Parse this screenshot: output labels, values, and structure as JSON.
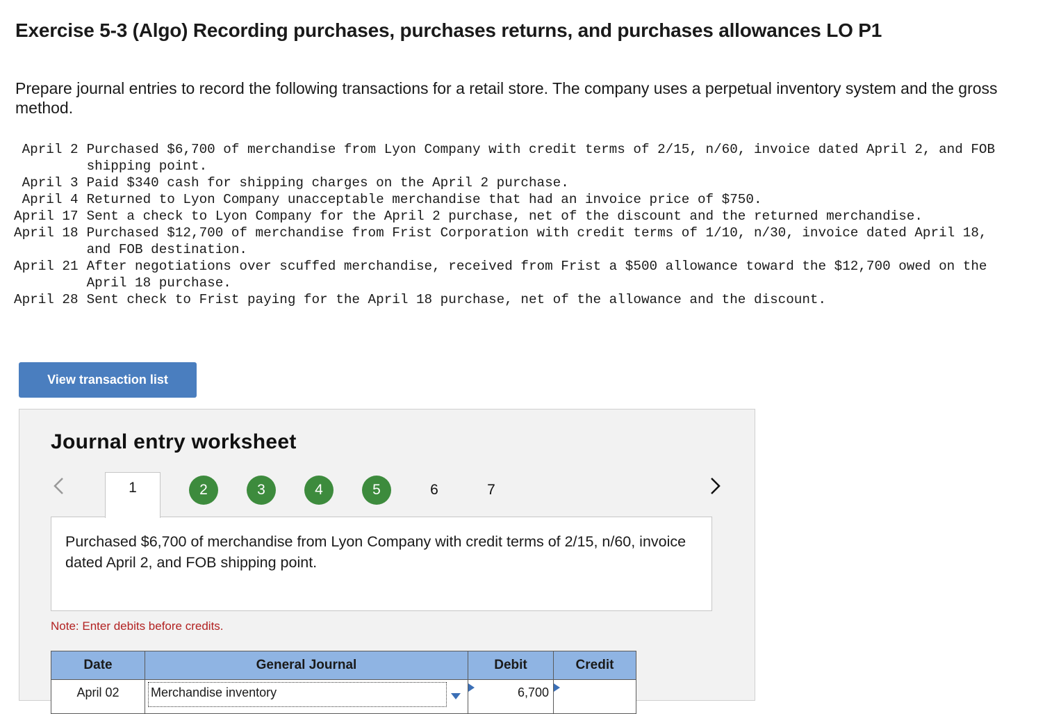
{
  "header": {
    "title": "Exercise 5-3 (Algo) Recording purchases, purchases returns, and purchases allowances LO P1",
    "intro": "Prepare journal entries to record the following transactions for a retail store. The company uses a perpetual inventory system and the gross method."
  },
  "transactions": [
    {
      "date": "April 2",
      "text": "Purchased $6,700 of merchandise from Lyon Company with credit terms of 2/15, n/60, invoice dated April 2, and FOB shipping point."
    },
    {
      "date": "April 3",
      "text": "Paid $340 cash for shipping charges on the April 2 purchase."
    },
    {
      "date": "April 4",
      "text": "Returned to Lyon Company unacceptable merchandise that had an invoice price of $750."
    },
    {
      "date": "April 17",
      "text": "Sent a check to Lyon Company for the April 2 purchase, net of the discount and the returned merchandise."
    },
    {
      "date": "April 18",
      "text": "Purchased $12,700 of merchandise from Frist Corporation with credit terms of 1/10, n/30, invoice dated April 18, and FOB destination."
    },
    {
      "date": "April 21",
      "text": "After negotiations over scuffed merchandise, received from Frist a $500 allowance toward the $12,700 owed on the April 18 purchase."
    },
    {
      "date": "April 28",
      "text": "Sent check to Frist paying for the April 18 purchase, net of the allowance and the discount."
    }
  ],
  "view_button": "View transaction list",
  "worksheet": {
    "title": "Journal entry worksheet",
    "steps": [
      {
        "label": "1",
        "state": "active"
      },
      {
        "label": "2",
        "state": "done"
      },
      {
        "label": "3",
        "state": "done"
      },
      {
        "label": "4",
        "state": "done"
      },
      {
        "label": "5",
        "state": "done"
      },
      {
        "label": "6",
        "state": "plain"
      },
      {
        "label": "7",
        "state": "plain"
      }
    ],
    "description": "Purchased $6,700 of merchandise from Lyon Company with credit terms of 2/15, n/60, invoice dated April 2, and FOB shipping point.",
    "note": "Note: Enter debits before credits.",
    "columns": {
      "date": "Date",
      "general_journal": "General Journal",
      "debit": "Debit",
      "credit": "Credit"
    },
    "rows": [
      {
        "date": "April 02",
        "account": "Merchandise inventory",
        "debit": "6,700",
        "credit": ""
      }
    ],
    "colors": {
      "header_bg": "#8fb4e3",
      "done_step": "#3d8b3d",
      "button": "#4a7ebf",
      "note": "#b22222"
    }
  }
}
